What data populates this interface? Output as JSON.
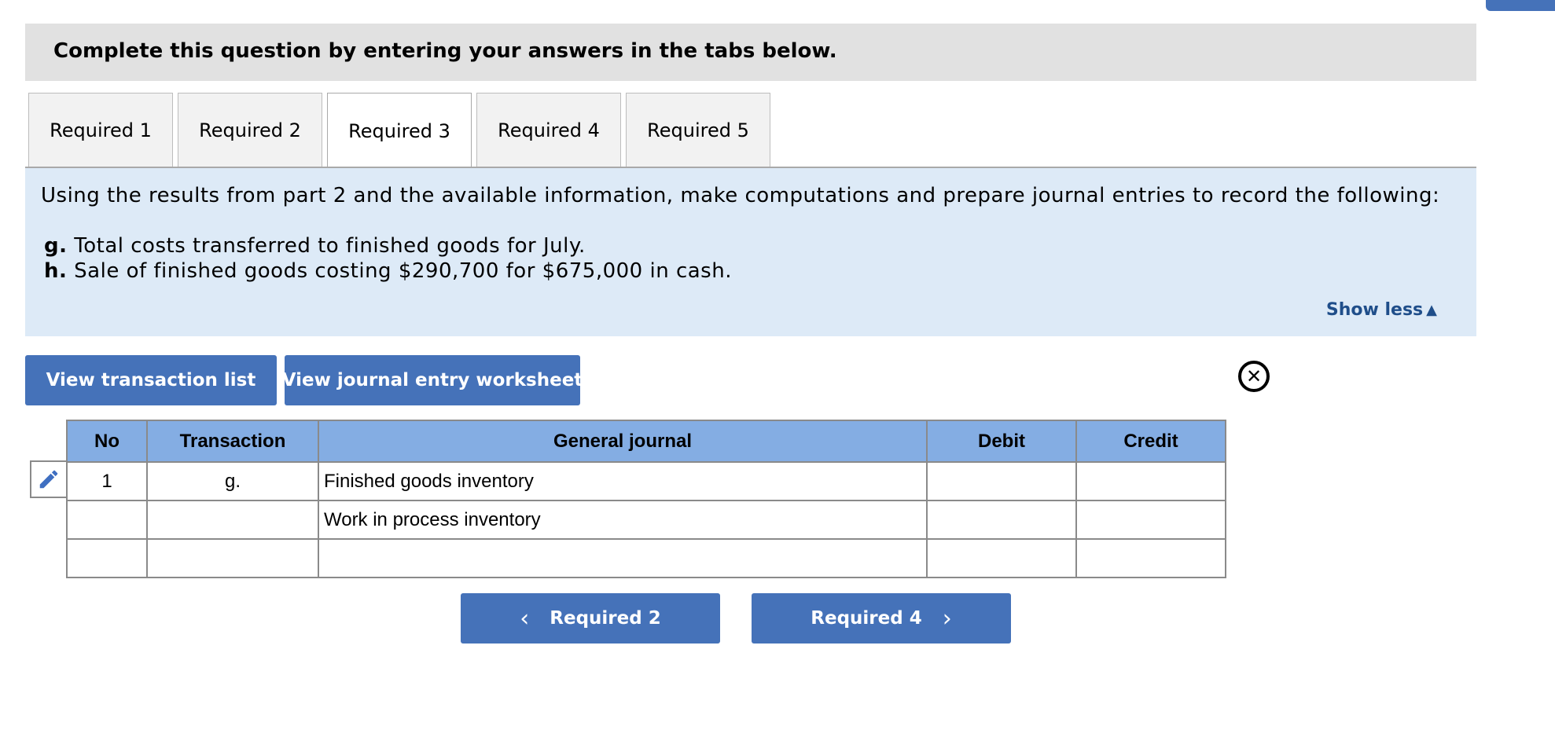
{
  "header": {
    "instruction": "Complete this question by entering your answers in the tabs below."
  },
  "tabs": [
    {
      "label": "Required 1"
    },
    {
      "label": "Required 2"
    },
    {
      "label": "Required 3"
    },
    {
      "label": "Required 4"
    },
    {
      "label": "Required 5"
    }
  ],
  "active_tab": "Required 3",
  "info": {
    "intro": "Using the results from part 2 and the available information, make computations and prepare journal entries to record the following:",
    "items": [
      {
        "label": "g.",
        "text": "Total costs transferred to finished goods for July."
      },
      {
        "label": "h.",
        "text": "Sale of finished goods costing $290,700 for $675,000 in cash."
      }
    ],
    "show_less": "Show less",
    "show_less_icon": "triangle-up-icon"
  },
  "buttons": {
    "view_transaction_list": "View transaction list",
    "view_journal_worksheet": "View journal entry worksheet",
    "close_icon": "close-circle-icon"
  },
  "journal": {
    "headers": {
      "no": "No",
      "transaction": "Transaction",
      "general_journal": "General journal",
      "debit": "Debit",
      "credit": "Credit"
    },
    "rows": [
      {
        "no": "1",
        "transaction": "g.",
        "account": "Finished goods inventory",
        "debit": "",
        "credit": ""
      },
      {
        "no": "",
        "transaction": "",
        "account": "Work in process inventory",
        "debit": "",
        "credit": ""
      },
      {
        "no": "",
        "transaction": "",
        "account": "",
        "debit": "",
        "credit": ""
      }
    ],
    "edit_icon": "pencil-icon"
  },
  "nav": {
    "prev_label": "Required 2",
    "next_label": "Required 4"
  },
  "colors": {
    "accent": "#4572b9",
    "table_header": "#84ade3",
    "info_panel": "#ddeaf7",
    "instruction_bar": "#e1e1e1"
  }
}
